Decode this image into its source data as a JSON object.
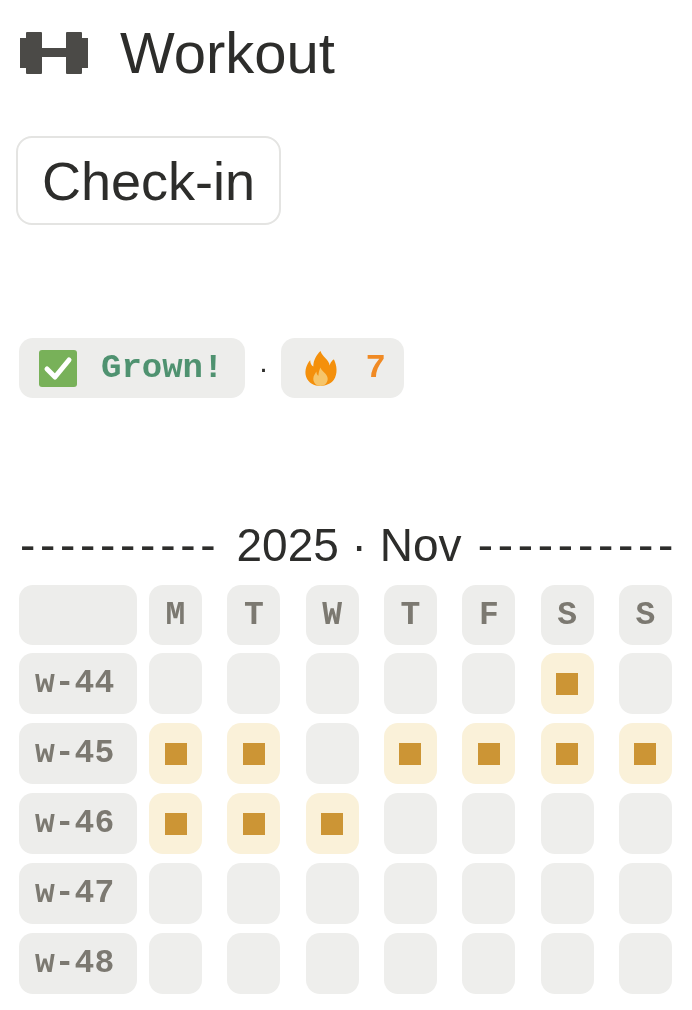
{
  "header": {
    "title": "Workout"
  },
  "check_in": {
    "label": "Check-in"
  },
  "status": {
    "badges": [
      {
        "kind": "grown",
        "label": "Grown!"
      },
      {
        "kind": "streak",
        "label": "7"
      }
    ],
    "separator": "·"
  },
  "calendar": {
    "rule_left": "----------",
    "title": "2025 · Nov",
    "rule_right": "----------",
    "weekdays": [
      "M",
      "T",
      "W",
      "T",
      "F",
      "S",
      "S"
    ],
    "weeks": [
      {
        "label": "w-44",
        "days": [
          {
            "checked": false
          },
          {
            "checked": false
          },
          {
            "checked": false
          },
          {
            "checked": false
          },
          {
            "checked": false
          },
          {
            "checked": true
          },
          {
            "checked": false
          }
        ]
      },
      {
        "label": "w-45",
        "days": [
          {
            "checked": true
          },
          {
            "checked": true
          },
          {
            "checked": false
          },
          {
            "checked": true
          },
          {
            "checked": true
          },
          {
            "checked": true
          },
          {
            "checked": true
          }
        ]
      },
      {
        "label": "w-46",
        "days": [
          {
            "checked": true
          },
          {
            "checked": true
          },
          {
            "checked": true
          },
          {
            "checked": false
          },
          {
            "checked": false
          },
          {
            "checked": false
          },
          {
            "checked": false
          }
        ]
      },
      {
        "label": "w-47",
        "days": [
          {
            "checked": false
          },
          {
            "checked": false
          },
          {
            "checked": false
          },
          {
            "checked": false
          },
          {
            "checked": false
          },
          {
            "checked": false
          },
          {
            "checked": false
          }
        ]
      },
      {
        "label": "w-48",
        "days": [
          {
            "checked": false
          },
          {
            "checked": false
          },
          {
            "checked": false
          },
          {
            "checked": false
          },
          {
            "checked": false
          },
          {
            "checked": false
          },
          {
            "checked": false
          }
        ]
      }
    ]
  }
}
